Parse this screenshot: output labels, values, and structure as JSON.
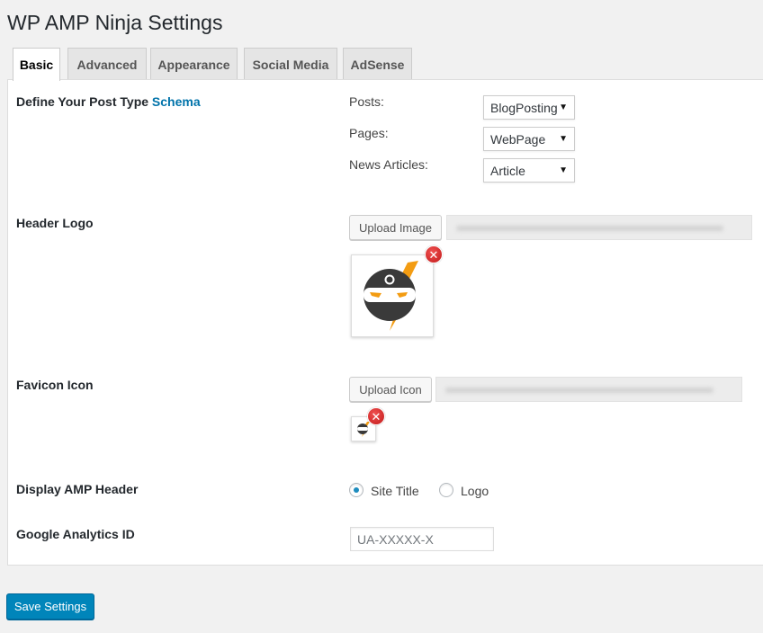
{
  "page": {
    "title": "WP AMP Ninja Settings"
  },
  "tabs": [
    {
      "label": "Basic",
      "active": true
    },
    {
      "label": "Advanced",
      "active": false
    },
    {
      "label": "Appearance",
      "active": false
    },
    {
      "label": "Social Media",
      "active": false
    },
    {
      "label": "AdSense",
      "active": false
    }
  ],
  "schema": {
    "label": "Define Your Post Type",
    "link_text": "Schema",
    "rows": [
      {
        "label": "Posts:",
        "value": "BlogPosting"
      },
      {
        "label": "Pages:",
        "value": "WebPage"
      },
      {
        "label": "News Articles:",
        "value": "Article"
      }
    ]
  },
  "header_logo": {
    "label": "Header Logo",
    "button_label": "Upload Image"
  },
  "favicon": {
    "label": "Favicon Icon",
    "button_label": "Upload Icon"
  },
  "amp_header": {
    "label": "Display AMP Header",
    "options": [
      {
        "label": "Site Title",
        "checked": true
      },
      {
        "label": "Logo",
        "checked": false
      }
    ]
  },
  "analytics": {
    "label": "Google Analytics ID",
    "placeholder": "UA-XXXXX-X",
    "value": ""
  },
  "footer": {
    "save_label": "Save Settings"
  },
  "colors": {
    "primary": "#0085ba",
    "link": "#0073aa",
    "remove": "#d22c2c",
    "logo_orange": "#f39c12",
    "logo_dark": "#3a3a3a"
  }
}
